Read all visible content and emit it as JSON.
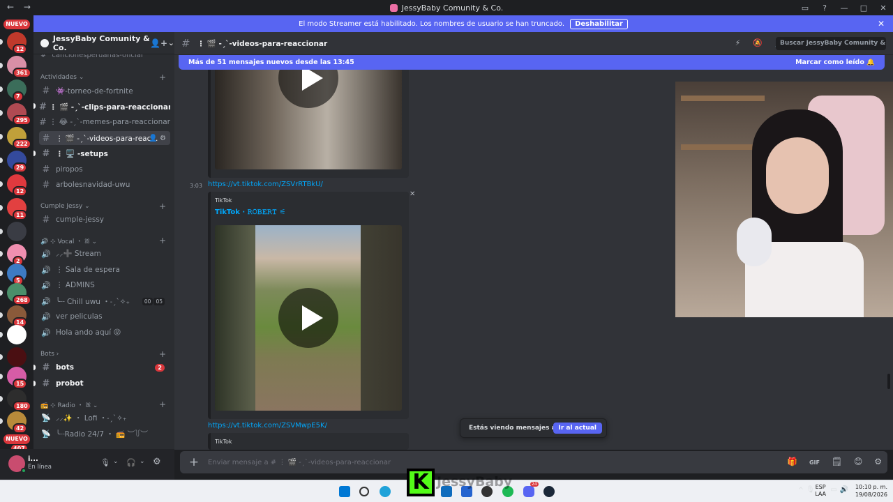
{
  "window": {
    "title": "JessyBaby Comunity & Co.",
    "back": "←",
    "forward": "→",
    "controls": [
      "▭",
      "?",
      "—",
      "□",
      "✕"
    ]
  },
  "rail": {
    "nuevo_top": "NUEVO",
    "nuevo_bottom": "NUEVO",
    "servers": [
      {
        "badge": "12",
        "color": "#c0392b"
      },
      {
        "badge": "361",
        "color": "#d98fa6"
      },
      {
        "badge": "7",
        "color": "#3b6d5a"
      },
      {
        "badge": "295",
        "color": "#b04a52"
      },
      {
        "badge": "222",
        "color": "#c0a03a"
      },
      {
        "badge": "29",
        "color": "#344a9c"
      },
      {
        "badge": "12",
        "color": "#e0393e"
      },
      {
        "badge": "11",
        "color": "#e24040"
      },
      {
        "badge": "",
        "color": "#3a3c44"
      },
      {
        "badge": "2",
        "color": "#f08fb0"
      },
      {
        "badge": "5",
        "color": "#3d7bc4"
      },
      {
        "badge": "268",
        "color": "#4a8f6a"
      },
      {
        "badge": "14",
        "color": "#8a5a3a"
      },
      {
        "badge": "",
        "color": "#ffffff"
      },
      {
        "badge": "",
        "color": "#4a0f12"
      },
      {
        "badge": "15",
        "color": "#d65ca6"
      },
      {
        "badge": "180",
        "color": "#2d2d2d"
      },
      {
        "badge": "42",
        "color": "#b88a3a"
      },
      {
        "badge": "407",
        "color": "#6b2d3a"
      }
    ]
  },
  "banner": {
    "text": "El modo Streamer está habilitado. Los nombres de usuario se han truncado.",
    "button": "Deshabilitar",
    "close": "✕"
  },
  "sidebar": {
    "guild_name": "JessyBaby Comunity & Co.",
    "chevron": "⌄",
    "invite_icon": "👤+",
    "cut_channel": "cancionesperuanas-oficial",
    "categories": [
      {
        "label": "Actividades ⌄"
      },
      {
        "label": "Cumple Jessy ⌄"
      },
      {
        "label": "🔊 ⊹ Vocal ・ ꕤ ⌄"
      },
      {
        "label": "Bots ›"
      },
      {
        "label": "📻 ⊹ Radio ・ ꕤ ⌄"
      }
    ],
    "channels": [
      {
        "label": "👾-torneo-de-fortnite"
      },
      {
        "label": "⋮ 🎬 -ˏˋ-clips-para-reaccionar"
      },
      {
        "label": "⋮ 😂 -ˏˋ-memes-para-reaccionar"
      },
      {
        "label": "⋮ 🎬 -ˏˋ-videos-para-reac..."
      },
      {
        "label": "⋮ 🖥️ -setups"
      },
      {
        "label": "piropos"
      },
      {
        "label": "arbolesnavidad-uwu"
      },
      {
        "label": "cumple-jessy"
      },
      {
        "label": "⸝⸝➕ Stream"
      },
      {
        "label": "⋮ Sala de espera"
      },
      {
        "label": "⋮ ADMINS"
      },
      {
        "label": "╰┈ Chill uwu ・˗ˏˋ✧₊"
      },
      {
        "label": "ver peliculas"
      },
      {
        "label": "Hola ando aquí 😝"
      },
      {
        "label": "bots"
      },
      {
        "label": "probot"
      },
      {
        "label": "⸝⸝✨ ・ Lofi ・˗ˏˋ✧₊"
      },
      {
        "label": "╰┈Radio 24/7 ・ 📻 ︶꒦︶"
      }
    ],
    "chill_counts": [
      "00",
      "05"
    ],
    "bots_badge": "2",
    "plus": "+"
  },
  "user": {
    "name": "i...",
    "status": "En línea",
    "mic": "🎙",
    "headset": "🎧",
    "settings": "⚙",
    "chevron": "⌄"
  },
  "header": {
    "hash": "#",
    "channel": "⋮ 🎬 -ˏˋ-videos-para-reaccionar",
    "tool_icons": [
      "⚡",
      "🔕",
      "📌",
      "👥"
    ],
    "search_placeholder": "Buscar JessyBaby Comunity & Co.",
    "search_icon": "🔍"
  },
  "newbar": {
    "text": "Más de 51 mensajes nuevos desde las 13:45",
    "mark": "Marcar como leído 🔔"
  },
  "messages": [
    {
      "time": "3:03",
      "link": "https://vt.tiktok.com/ZSVrRTBkU/",
      "provider": "TikTok",
      "title": "TikTok · 𝚁𝙾𝙱𝙴𝚁𝚃 ⚟",
      "close": "✕"
    },
    {
      "link": "https://vt.tiktok.com/ZSVMwpE5K/",
      "provider": "TikTok"
    }
  ],
  "toast": {
    "text": "Estás viendo mensajes antiguos",
    "button": "Ir al actual"
  },
  "composer": {
    "placeholder": "Enviar mensaje a # ⋮ 🎬 -ˏˋ-videos-para-reaccionar",
    "plus": "+",
    "icons": [
      "🎁",
      "GIF",
      "🗒",
      "😊",
      "⚙"
    ]
  },
  "overlay": {
    "k_logo": "K",
    "name": "JessyBaby"
  },
  "taskbar": {
    "lang_top": "ESP",
    "lang_bottom": "LAA",
    "time": "10:10 p. m.",
    "date": "19/08/2026",
    "tray_icons": [
      "^",
      "🎙",
      "▭",
      "🔊"
    ],
    "app_badge": "24",
    "apps": [
      "windows",
      "search",
      "edge",
      "explorer",
      "k-logo",
      "outlook",
      "todo",
      "obs",
      "spotify",
      "discord",
      "steam"
    ]
  }
}
